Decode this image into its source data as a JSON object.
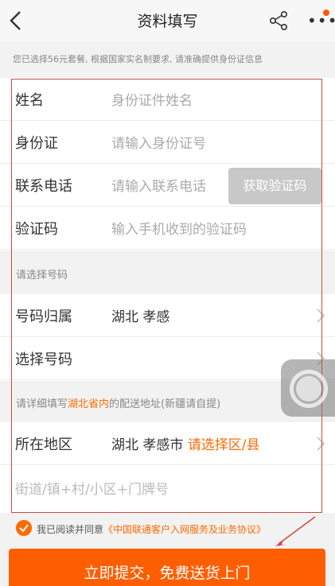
{
  "header": {
    "title": "资料填写"
  },
  "notice": "您已选择56元套餐, 根据国家实名制要求, 请准确提供身份证信息",
  "identity": {
    "name_label": "姓名",
    "name_placeholder": "身份证件姓名",
    "id_label": "身份证",
    "id_placeholder": "请输入身份证号",
    "phone_label": "联系电话",
    "phone_placeholder": "请输入联系电话",
    "otp_button": "获取验证码",
    "code_label": "验证码",
    "code_placeholder": "输入手机收到的验证码"
  },
  "number_section": {
    "title": "请选择号码",
    "region_label": "号码归属",
    "region_value": "湖北 孝感",
    "select_label": "选择号码"
  },
  "address_section": {
    "title_pre": "请详细填写",
    "title_highlight": "湖北省内",
    "title_post": "的配送地址(新疆请自提)",
    "area_label": "所在地区",
    "area_value": "湖北 孝感市",
    "area_select": "请选择区/县",
    "street_placeholder": "街道/镇+村/小区+门牌号"
  },
  "agreement": {
    "text": "我已阅读并同意",
    "link": "《中国联通客户入网服务及业务协议》"
  },
  "submit_label": "立即提交，免费送货上门",
  "colors": {
    "accent": "#ff5e00",
    "highlight_border": "#d6463c",
    "disabled_button": "#c8c8c8"
  }
}
